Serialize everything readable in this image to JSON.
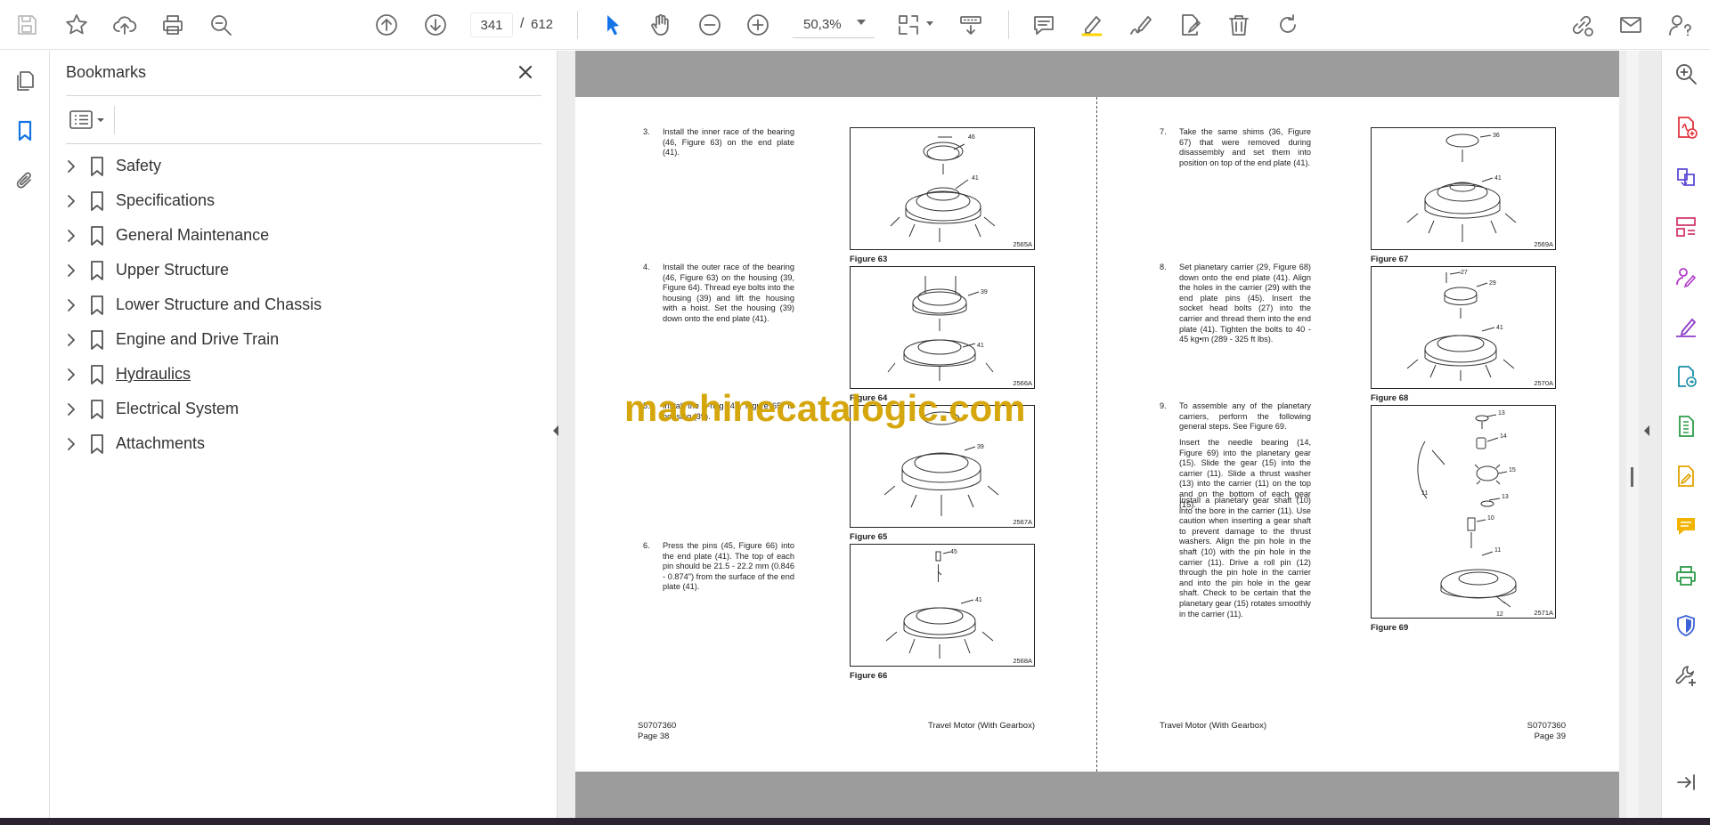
{
  "toolbar": {
    "current_page": "341",
    "page_separator": "/",
    "total_pages": "612",
    "zoom": "50,3%"
  },
  "bookmarks": {
    "title": "Bookmarks",
    "items": [
      {
        "label": "Safety"
      },
      {
        "label": "Specifications"
      },
      {
        "label": "General Maintenance"
      },
      {
        "label": "Upper Structure"
      },
      {
        "label": "Lower Structure and Chassis"
      },
      {
        "label": "Engine and Drive Train"
      },
      {
        "label": "Hydraulics"
      },
      {
        "label": "Electrical System"
      },
      {
        "label": "Attachments"
      }
    ]
  },
  "left_page": {
    "steps": [
      {
        "num": "3.",
        "text": "Install the inner race of the bearing (46, Figure 63) on the end plate (41)."
      },
      {
        "num": "4.",
        "text": "Install the outer race of the bearing (46, Figure 63) on the housing (39, Figure 64). Thread eye bolts into the housing (39) and lift the housing with a hoist. Set the housing (39) down onto the end plate (41)."
      },
      {
        "num": "5.",
        "text": "Install the o-ring (47, Figure 65) to housing (39)."
      },
      {
        "num": "6.",
        "text": "Press the pins (45, Figure 66) into the end plate (41). The top of each pin should be 21.5 - 22.2 mm (0.846 - 0.874\") from the surface of the end plate (41)."
      }
    ],
    "figures": [
      {
        "caption": "Figure 63",
        "code": "2565A",
        "labels": [
          "46",
          "41"
        ]
      },
      {
        "caption": "Figure 64",
        "code": "2566A",
        "labels": [
          "39",
          "41"
        ]
      },
      {
        "caption": "Figure 65",
        "code": "2567A",
        "labels": [
          "47",
          "39"
        ]
      },
      {
        "caption": "Figure 66",
        "code": "2568A",
        "labels": [
          "45",
          "41"
        ]
      }
    ],
    "footer": {
      "doc": "S0707360",
      "page": "Page 38",
      "section": "Travel Motor (With Gearbox)"
    }
  },
  "right_page": {
    "steps": [
      {
        "num": "7.",
        "text": "Take the same shims (36, Figure 67) that were removed during disassembly and set them into position on top of the end plate (41)."
      },
      {
        "num": "8.",
        "text": "Set planetary carrier (29, Figure 68) down onto the end plate (41). Align the holes in the carrier (29) with the end plate pins (45). Insert the socket head bolts (27) into the carrier and thread them into the end plate (41). Tighten the bolts to 40 - 45 kg•m (289 - 325 ft lbs)."
      },
      {
        "num": "9.",
        "text": "To assemble any of the planetary carriers, perform the following general steps. See Figure 69."
      }
    ],
    "paragraphs": [
      "Insert the needle bearing (14, Figure 69) into the planetary gear (15). Slide the gear (15) into the carrier (11). Slide a thrust washer (13) into the carrier (11) on the top and on the bottom of each gear (15).",
      "Install a planetary gear shaft (10) into the bore in the carrier (11). Use caution when inserting a gear shaft to prevent damage to the thrust washers. Align the pin hole in the shaft (10) with the pin hole in the carrier (11). Drive a roll pin (12) through the pin hole in the carrier and into the pin hole in the gear shaft. Check to be certain that the planetary gear (15) rotates smoothly in the carrier (11)."
    ],
    "figures": [
      {
        "caption": "Figure 67",
        "code": "2569A",
        "labels": [
          "36",
          "41"
        ]
      },
      {
        "caption": "Figure 68",
        "code": "2570A",
        "labels": [
          "27",
          "29",
          "41"
        ]
      },
      {
        "caption": "Figure 69",
        "code": "2571A",
        "labels": [
          "13",
          "14",
          "15",
          "11",
          "13",
          "10",
          "11",
          "12"
        ]
      }
    ],
    "footer": {
      "doc": "S0707360",
      "page": "Page 39",
      "section": "Travel Motor (With Gearbox)"
    }
  },
  "watermark": "machinecatalogic.com",
  "colors": {
    "accent": "#1473e6",
    "watermark": "#d4a300",
    "page_bg": "#9c9c9c"
  }
}
